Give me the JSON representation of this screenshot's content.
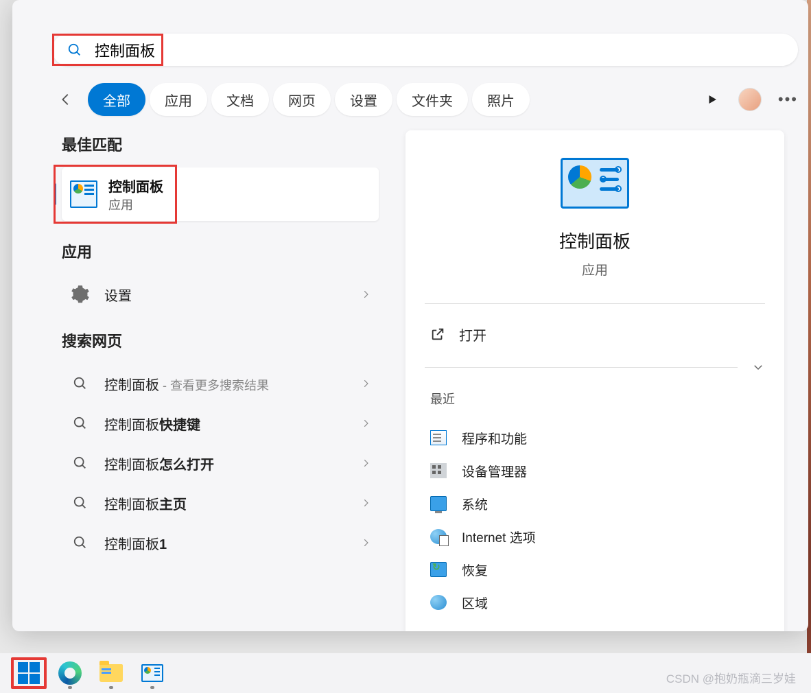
{
  "search": {
    "query": "控制面板"
  },
  "tabs": [
    "全部",
    "应用",
    "文档",
    "网页",
    "设置",
    "文件夹",
    "照片"
  ],
  "active_tab_index": 0,
  "sections": {
    "best_match": "最佳匹配",
    "apps": "应用",
    "search_web": "搜索网页"
  },
  "best_match": {
    "title": "控制面板",
    "subtitle": "应用"
  },
  "apps_list": [
    {
      "label": "设置"
    }
  ],
  "web_results": [
    {
      "prefix": "控制面板",
      "bold": "",
      "suffix": " - 查看更多搜索结果"
    },
    {
      "prefix": "控制面板",
      "bold": "快捷键",
      "suffix": ""
    },
    {
      "prefix": "控制面板",
      "bold": "怎么打开",
      "suffix": ""
    },
    {
      "prefix": "控制面板",
      "bold": "主页",
      "suffix": ""
    },
    {
      "prefix": "控制面板",
      "bold": "1",
      "suffix": ""
    }
  ],
  "detail": {
    "title": "控制面板",
    "subtitle": "应用",
    "open_label": "打开",
    "recent_header": "最近",
    "recent": [
      "程序和功能",
      "设备管理器",
      "系统",
      "Internet 选项",
      "恢复",
      "区域"
    ]
  },
  "watermark": "CSDN @抱奶瓶滴三岁娃"
}
